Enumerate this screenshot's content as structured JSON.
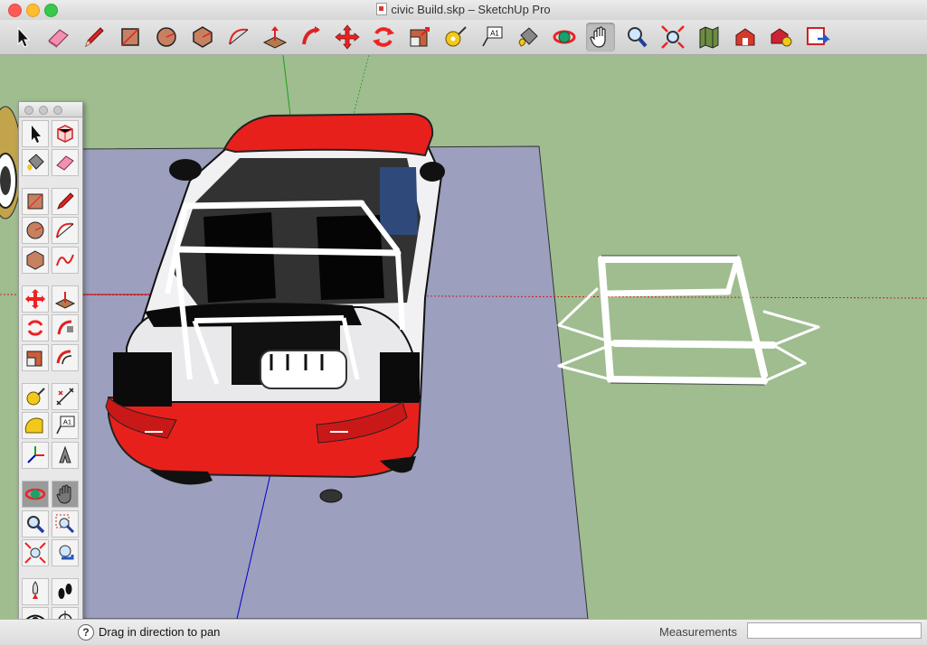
{
  "window": {
    "title": "civic Build.skp – SketchUp Pro"
  },
  "toolbar": {
    "tools": [
      {
        "name": "select-tool",
        "icon": "arrow-cursor-icon"
      },
      {
        "name": "eraser-tool",
        "icon": "eraser-icon"
      },
      {
        "name": "pencil-tool",
        "icon": "pencil-icon"
      },
      {
        "name": "rectangle-tool",
        "icon": "rectangle-icon"
      },
      {
        "name": "circle-tool",
        "icon": "circle-icon"
      },
      {
        "name": "polygon-tool",
        "icon": "polygon-icon"
      },
      {
        "name": "arc-tool",
        "icon": "arc-icon"
      },
      {
        "name": "push-pull-tool",
        "icon": "push-pull-icon"
      },
      {
        "name": "follow-me-tool",
        "icon": "follow-me-icon"
      },
      {
        "name": "move-tool",
        "icon": "move-icon"
      },
      {
        "name": "rotate-tool",
        "icon": "rotate-icon"
      },
      {
        "name": "scale-tool",
        "icon": "scale-icon"
      },
      {
        "name": "tape-measure-tool",
        "icon": "tape-measure-icon"
      },
      {
        "name": "text-tool",
        "icon": "text-label-icon"
      },
      {
        "name": "paint-bucket-tool",
        "icon": "paint-bucket-icon"
      },
      {
        "name": "orbit-tool",
        "icon": "orbit-icon"
      },
      {
        "name": "pan-tool",
        "icon": "hand-icon"
      },
      {
        "name": "zoom-tool",
        "icon": "magnifier-icon"
      },
      {
        "name": "zoom-extents-tool",
        "icon": "zoom-extents-icon"
      },
      {
        "name": "add-location-tool",
        "icon": "map-icon"
      },
      {
        "name": "3d-warehouse-tool",
        "icon": "warehouse-icon"
      },
      {
        "name": "extension-warehouse-tool",
        "icon": "extension-icon"
      },
      {
        "name": "send-to-layout-tool",
        "icon": "layout-icon"
      }
    ],
    "text_tool_label": "A1"
  },
  "palette": {
    "text_tool_label": "A1"
  },
  "status": {
    "help": "?",
    "message": "Drag in direction to pan"
  },
  "measurements": {
    "label": "Measurements",
    "value": ""
  },
  "colors": {
    "ground": "#9fbd8f",
    "plane": "#9c9fbd",
    "car_body": "#e8201c",
    "red_axis": "#d00000",
    "green_axis": "#1aa01a",
    "blue_axis": "#0000cc"
  }
}
